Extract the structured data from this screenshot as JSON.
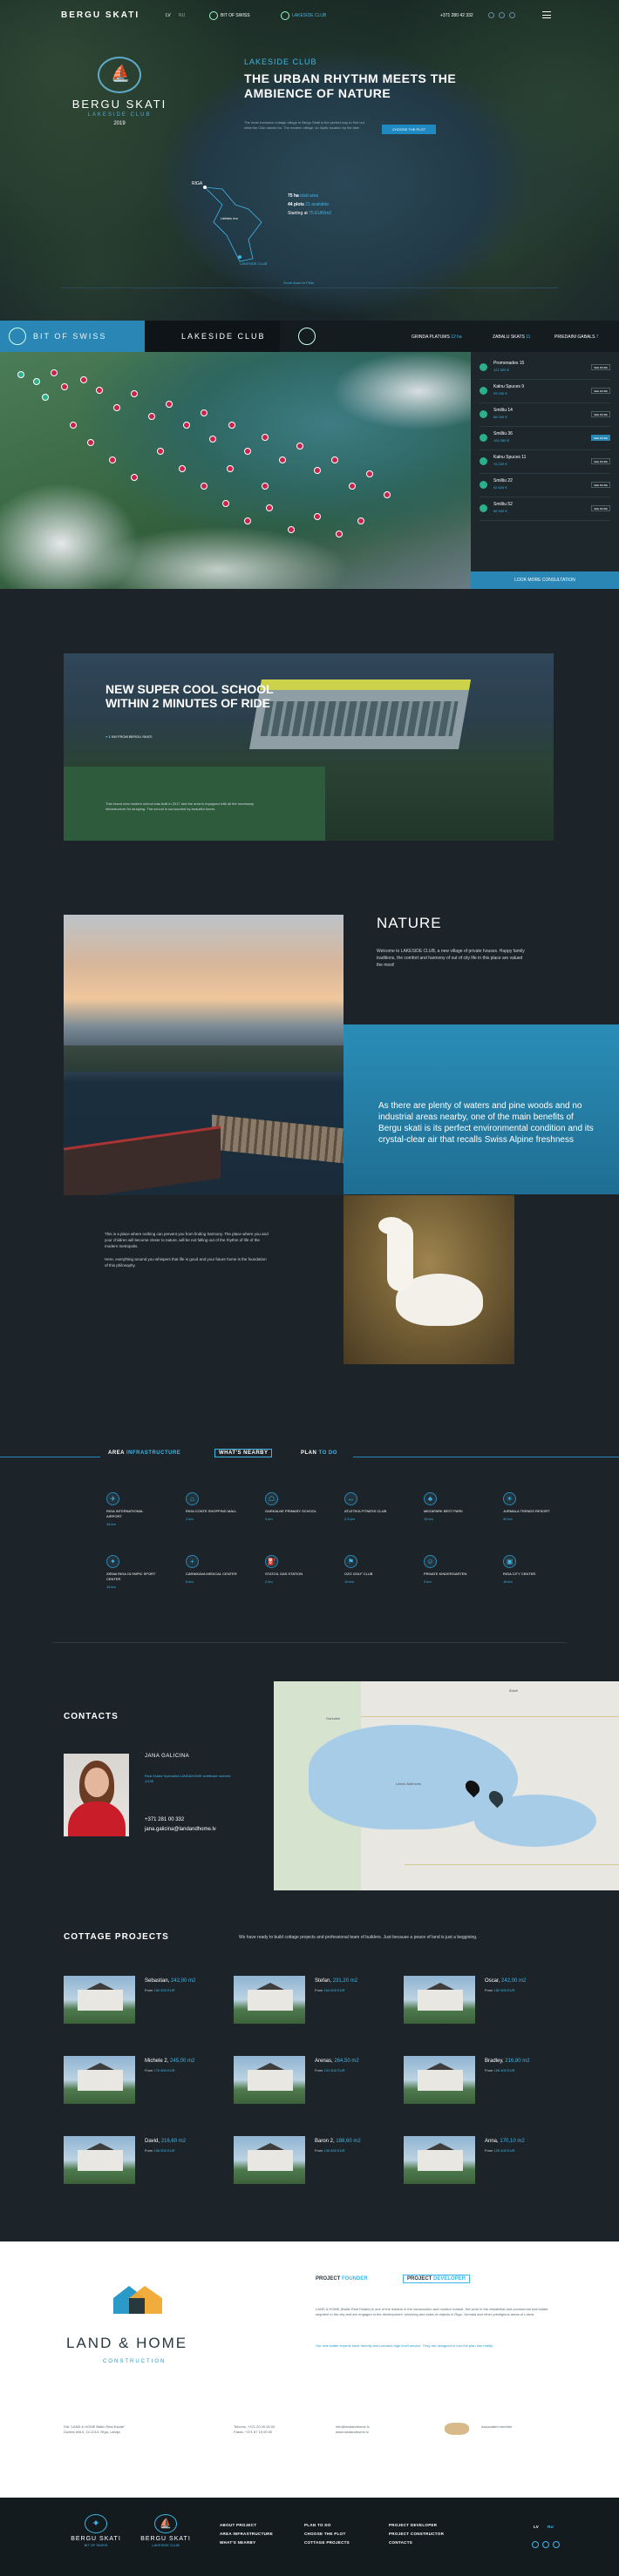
{
  "nav": {
    "brand": "BERGU SKATI",
    "lang1": "LV",
    "lang2": "RU",
    "club1": "BIT OF SWISS",
    "club2": "LAKESIDE CLUB",
    "phone": "+371 280 42 332"
  },
  "hero": {
    "crest_name": "BERGU SKATI",
    "crest_sub": "LAKESIDE CLUB",
    "crest_year": "2019",
    "kicker": "LAKESIDE CLUB",
    "title": "THE URBAN RHYTHM MEETS THE AMBIENCE OF NATURE",
    "desc": "The most exclusive cottage village in Bergu Skati is the perfect way to find out what the Club stands for. The modern village, an idyllic location by the lake",
    "button": "CHOOSE THE PLOT",
    "map_label1": "RIGA",
    "map_label2": "Lielrides riva",
    "map_label3": "LAKESIDE CLUB",
    "stat1a": "75 ha",
    "stat1b": "total area",
    "stat2a": "44 plots",
    "stat2b": "21 available",
    "stat3a": "Starting at",
    "stat3b": "75 EUR/m2",
    "scroll": "Scroll down to Plots"
  },
  "clubbar": {
    "tab1": "BIT OF SWISS",
    "tab2": "LAKESIDE CLUB",
    "s1": "GRINDA PLATUMS",
    "s1v": "12 ha",
    "s2": "ZABALU SKATS",
    "s2v": "11",
    "s3": "PRIEDAINI GABALS",
    "s3v": "7"
  },
  "plots": [
    {
      "name": "Promenades 15",
      "price": "121 500 €",
      "btn": "SEE MORE"
    },
    {
      "name": "Kalnu Spuces 9",
      "price": "99 150 €",
      "btn": "SEE MORE"
    },
    {
      "name": "Smilšu 14",
      "price": "88 040 €",
      "btn": "SEE MORE"
    },
    {
      "name": "Smilšu 36",
      "price": "104 280 €",
      "btn": "SEE MORE"
    },
    {
      "name": "Kalnu Spuces 11",
      "price": "76 200 €",
      "btn": "SEE MORE"
    },
    {
      "name": "Smilšu 22",
      "price": "92 620 €",
      "btn": "SEE MORE"
    },
    {
      "name": "Smilšu 52",
      "price": "85 300 €",
      "btn": "SEE MORE"
    }
  ],
  "reserve": "LOOK MORE CONSULTATION",
  "school": {
    "title": "NEW SUPER COOL SCHOOL WITHIN 2 MINUTES OF RIDE",
    "loc": "1 KM FROM BERGU SKATI",
    "desc": "This brand new modern school was built in 2017 and the area is equipped with all the necessary infrastructure for studying. The school is surrounded by beautiful forest."
  },
  "nature": {
    "title": "NATURE",
    "desc": "Welcome to LAKESIDE CLUB, a new village of private houses. Happy family traditions, the comfort and harmony of out of city life in this place are valued the most!",
    "quote": "As there are plenty of waters and pine woods and no industrial areas nearby, one of the main benefits of Bergu skati is its perfect environmental condition and its crystal-clear air that recalls Swiss Alpine freshness",
    "p1": "This is a place where nothing can prevent you from finding harmony. The place where you and your children will become closer to nature, will be not falling out of the rhythm of life of the modern metropolis.",
    "p2": "Here, everything around you whispers that life is good and your future home is the foundation of this philosophy."
  },
  "infra": {
    "tab1a": "AREA",
    "tab1b": "INFRASTRUCTURE",
    "tab2": "WHAT'S NEARBY",
    "tab3a": "PLAN",
    "tab3b": "TO DO",
    "items": [
      {
        "name": "RIGA INTERNATIONAL AIRPORT",
        "dist": "18 km",
        "icon": "plane-icon",
        "g": "✈"
      },
      {
        "name": "RIGA CONTE SHOPPING MALL",
        "dist": "2 km",
        "icon": "shopping-icon",
        "g": "⌂"
      },
      {
        "name": "GARKALNE PRIMARY SCHOOL",
        "dist": "4 km",
        "icon": "school-icon",
        "g": "☖"
      },
      {
        "name": "ATLETIKA FITNESS CLUB",
        "dist": "2.5 km",
        "icon": "fitness-icon",
        "g": "↔"
      },
      {
        "name": "MEZAPARK BEST PARK",
        "dist": "15 km",
        "icon": "park-icon",
        "g": "♣"
      },
      {
        "name": "JURMALA TRENDS RESORT",
        "dist": "40 km",
        "icon": "resort-icon",
        "g": "☀"
      },
      {
        "name": "ZIEMA RIGA OLYMPIC SPORT CENTER",
        "dist": "16 km",
        "icon": "sport-icon",
        "g": "✦"
      },
      {
        "name": "CARNIKAVA MEDICAL CENTER",
        "dist": "6 km",
        "icon": "medical-icon",
        "g": "+"
      },
      {
        "name": "STATOIL GAS STATION",
        "dist": "2 km",
        "icon": "gas-icon",
        "g": "⛽"
      },
      {
        "name": "OZO GOLF CLUB",
        "dist": "10 km",
        "icon": "golf-icon",
        "g": "⚑"
      },
      {
        "name": "PRIVATE KINDERGARTEN",
        "dist": "3 km",
        "icon": "kindergarten-icon",
        "g": "☺"
      },
      {
        "name": "RIGA CITY CENTER",
        "dist": "18 km",
        "icon": "city-icon",
        "g": "▣"
      }
    ]
  },
  "contacts": {
    "title": "CONTACTS",
    "name": "JANA GALICINA",
    "role": "Real Estate Specialist LAND&HOME sertificate number: 1/135",
    "phone": "+371 281 00 332",
    "mail": "jana.galicina@landandhome.lv"
  },
  "map": {
    "l1": "Garkalne",
    "l2": "Lielais Baltezers",
    "l3": "Ādaži"
  },
  "projects": {
    "title": "COTTAGE PROJECTS",
    "sub": "We have ready to build cottage projects and professional team of builders. Just because a peace of land is just a beggining.",
    "items": [
      {
        "name": "Sebastian,",
        "area": "242,00 m2",
        "from": "From",
        "price": "180 500 EUR"
      },
      {
        "name": "Stefan,",
        "area": "231,20 m2",
        "from": "From",
        "price": "164 600 EUR"
      },
      {
        "name": "Oscar,",
        "area": "242,00 m2",
        "from": "From",
        "price": "180 500 EUR"
      },
      {
        "name": "Michele 2,",
        "area": "245,00 m2",
        "from": "From",
        "price": "176 800 EUR"
      },
      {
        "name": "Arenas,",
        "area": "264,50 m2",
        "from": "From",
        "price": "191 500 EUR"
      },
      {
        "name": "Bradley,",
        "area": "216,80 m2",
        "from": "From",
        "price": "158 400 EUR"
      },
      {
        "name": "David,",
        "area": "216,60 m2",
        "from": "From",
        "price": "158 500 EUR"
      },
      {
        "name": "Baron 2,",
        "area": "188,60 m2",
        "from": "From",
        "price": "139 800 EUR"
      },
      {
        "name": "Anna,",
        "area": "170,10 m2",
        "from": "From",
        "price": "126 400 EUR"
      }
    ]
  },
  "developer": {
    "name": "LAND & HOME",
    "sub": "CONSTRUCTION",
    "tab1a": "PROJECT",
    "tab1b": "FOUNDER",
    "tab2a": "PROJECT",
    "tab2b": "DEVELOPER",
    "p1": "LAND & HOME (Baltic Real Estate) is one of the leaders in the construction and modern market. We work in the residential and commercial real estate segment in the city and are engaged in the development, servicing and sales of objects in Riga, Jurmala and other prestigious areas of Latvia.",
    "p2": "Our real estate experts have friendly and provides high-level service. They are designed to turn the plan into reality.",
    "f1a": "SIA \"LAND & HOME Baltic Real Estate\"",
    "f1b": "Duntes ielā 6, LV-1013, Rīga, Latvija",
    "f2a": "Tel/ums: +371 20 00 00 00",
    "f2b": "Fakss: +371 67 15 00 00",
    "f3a": "info@landandhome.lv",
    "f3b": "www.landandhome.lv",
    "f4": "Associated member"
  },
  "footer": {
    "l1": "BERGU SKATI",
    "l1s": "BIT OF SWISS",
    "l2": "BERGU SKATI",
    "l2s": "LAKESIDE CLUB",
    "c1": [
      "ABOUT PROJECT",
      "AREA INFRASTRUCTURE",
      "WHAT'S NEARBY"
    ],
    "c2": [
      "PLAN TO DO",
      "CHOOSE THE PLOT",
      "COTTAGE PROJECTS"
    ],
    "c3": [
      "PROJECT DEVELOPER",
      "PROJECT CONSTRUCTOR",
      "CONTACTS"
    ],
    "lang1": "LV",
    "lang2": "RU"
  },
  "colors": {
    "accent": "#3fb6e8",
    "blue": "#2a87b5",
    "dark": "#1c2429",
    "plot_sold": "#c8234a",
    "plot_free": "#2cb08a"
  }
}
